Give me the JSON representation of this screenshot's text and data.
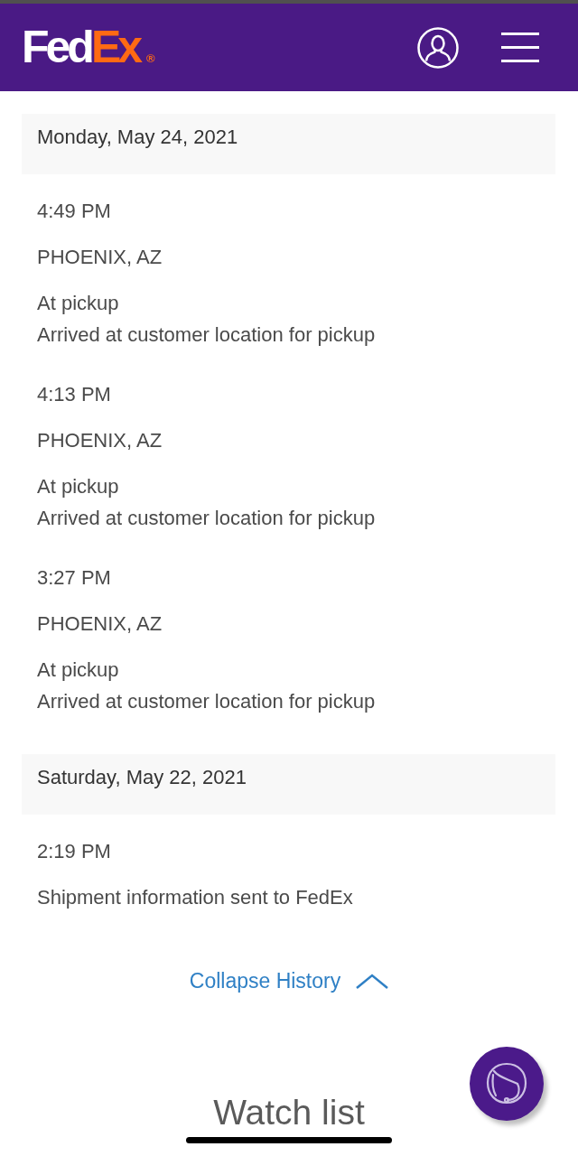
{
  "header": {
    "logo": {
      "part_1": "Fed",
      "part_2": "Ex",
      "mark": "®"
    }
  },
  "history": [
    {
      "date": "Monday, May 24, 2021",
      "events": [
        {
          "time": "4:49 PM",
          "location": "PHOENIX, AZ",
          "status": "At pickup",
          "description": "Arrived at customer location for pickup"
        },
        {
          "time": "4:13 PM",
          "location": "PHOENIX, AZ",
          "status": "At pickup",
          "description": "Arrived at customer location for pickup"
        },
        {
          "time": "3:27 PM",
          "location": "PHOENIX, AZ",
          "status": "At pickup",
          "description": "Arrived at customer location for pickup"
        }
      ]
    },
    {
      "date": "Saturday, May 22, 2021",
      "events": [
        {
          "time": "2:19 PM",
          "description": "Shipment information sent to FedEx"
        }
      ]
    }
  ],
  "collapse_link": {
    "label": "Collapse History",
    "expanded": true
  },
  "watch_list": {
    "title": "Watch list"
  }
}
